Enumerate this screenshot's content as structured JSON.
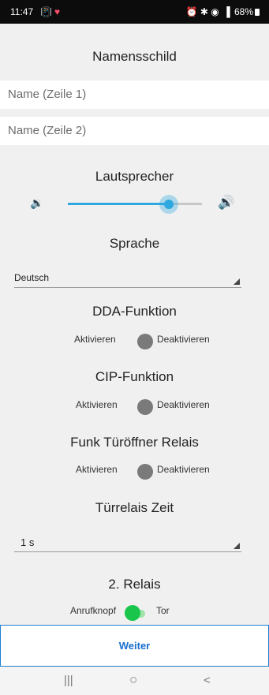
{
  "status_bar": {
    "time": "11:47",
    "left_icons": "📳",
    "heart": "♥",
    "right_icons": "⏰ ✱ ◉",
    "signal": "▐",
    "battery": "68%"
  },
  "nameplate": {
    "title": "Namensschild",
    "line1_placeholder": "Name (Zeile 1)",
    "line2_placeholder": "Name (Zeile 2)"
  },
  "speaker": {
    "title": "Lautsprecher",
    "volume_low_icon": "speaker-low-icon",
    "volume_high_icon": "speaker-high-icon",
    "level": 0.75
  },
  "language": {
    "title": "Sprache",
    "selected": "Deutsch"
  },
  "dda": {
    "title": "DDA-Funktion",
    "label_on": "Aktivieren",
    "label_off": "Deaktivieren",
    "state": "off"
  },
  "cip": {
    "title": "CIP-Funktion",
    "label_on": "Aktivieren",
    "label_off": "Deaktivieren",
    "state": "off"
  },
  "radio_relay": {
    "title": "Funk Türöffner Relais",
    "label_on": "Aktivieren",
    "label_off": "Deaktivieren",
    "state": "off"
  },
  "door_relay_time": {
    "title": "Türrelais Zeit",
    "selected": "1 s"
  },
  "relay2": {
    "title": "2. Relais",
    "label_left": "Anrufknopf",
    "label_right": "Tor",
    "state": "on"
  },
  "footer": {
    "next_label": "Weiter"
  },
  "nav": {
    "recent": "|||",
    "home": "○",
    "back": "<"
  },
  "colors": {
    "accent": "#2fa8df",
    "toggle_on": "#19c64b",
    "button_text": "#1a6fcf"
  }
}
